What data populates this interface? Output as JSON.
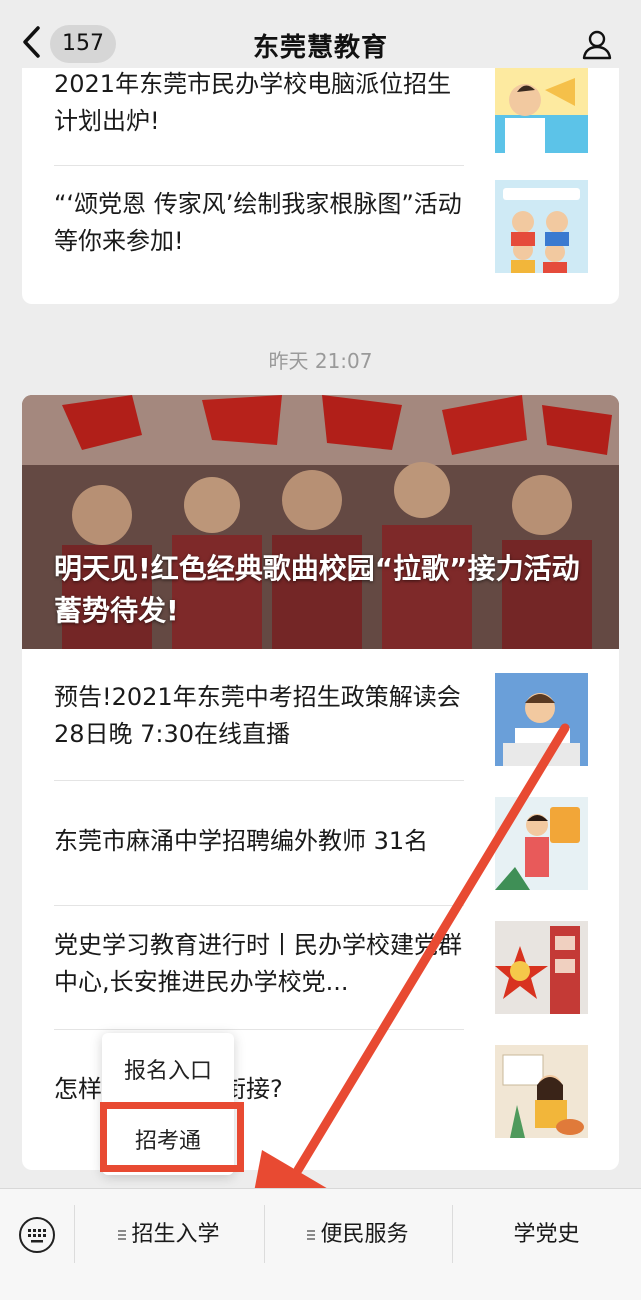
{
  "header": {
    "unread_count": "157",
    "title": "东莞慧教育"
  },
  "feed_top": {
    "items": [
      {
        "title": "2021年东莞市民办学校电脑派位招生计划出炉!"
      },
      {
        "title": "“‘颂党恩 传家风’绘制我家根脉图”活动等你来参加!"
      }
    ]
  },
  "timestamp": "昨天 21:07",
  "feed_main": {
    "hero_title": "明天见!红色经典歌曲校园“拉歌”接力活动蓄势待发!",
    "items": [
      {
        "title": "预告!2021年东莞中考招生政策解读会 28日晚 7:30在线直播"
      },
      {
        "title": "东莞市麻涌中学招聘编外教师 31名"
      },
      {
        "title": "党史学习教育进行时丨民办学校建党群中心,长安推进民办学校党..."
      },
      {
        "title": "怎样做好初高中衔接?"
      }
    ]
  },
  "popup_menu": {
    "items": [
      "报名入口",
      "招考通"
    ]
  },
  "bottom_menu": {
    "tabs": [
      "招生入学",
      "便民服务",
      "学党史"
    ]
  },
  "colors": {
    "accent_arrow": "#e84a32",
    "background": "#ededed"
  },
  "icons": {
    "back": "chevron-left-icon",
    "user": "user-icon",
    "keyboard": "keyboard-icon",
    "submenu": "menu-lines-icon"
  }
}
